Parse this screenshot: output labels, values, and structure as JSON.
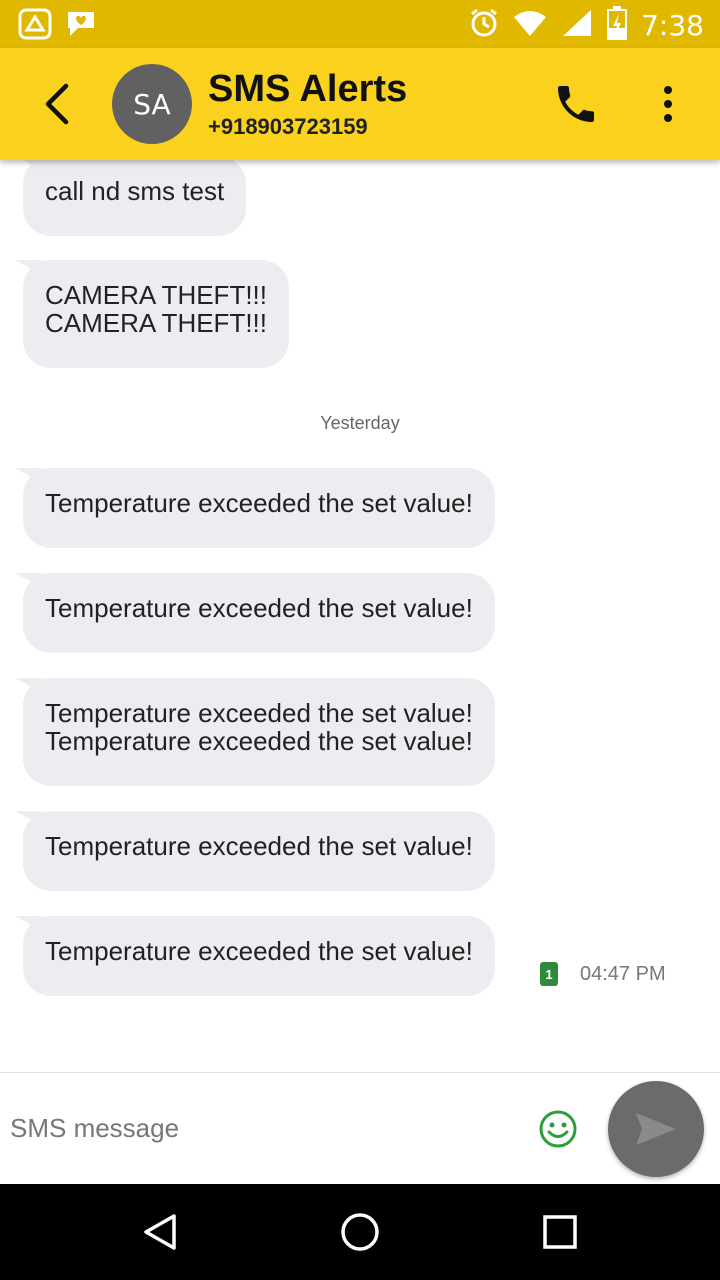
{
  "status_bar": {
    "time": "7:38",
    "icons": [
      "app-notification-icon",
      "chat-notification-icon",
      "alarm-icon",
      "wifi-icon",
      "signal-icon",
      "battery-charging-icon"
    ]
  },
  "header": {
    "avatar_initials": "SA",
    "contact_name": "SMS Alerts",
    "contact_number": "+918903723159",
    "icons": [
      "back-arrow-icon",
      "phone-icon",
      "more-vert-icon"
    ]
  },
  "messages": [
    {
      "text": "call nd sms test"
    },
    {
      "text": "CAMERA THEFT!!!\nCAMERA THEFT!!!"
    },
    {
      "text": "Temperature exceeded the set value!"
    },
    {
      "text": "Temperature exceeded the set value!"
    },
    {
      "text": "Temperature exceeded the set value!\nTemperature exceeded the set value!"
    },
    {
      "text": "Temperature exceeded the set value!"
    },
    {
      "text": "Temperature exceeded the set value!"
    }
  ],
  "date_separator": "Yesterday",
  "last_message_meta": {
    "sim_slot": "1",
    "time": "04:47 PM"
  },
  "composer": {
    "placeholder": "SMS message",
    "icons": [
      "emoji-icon",
      "send-icon"
    ]
  },
  "navigation": {
    "icons": [
      "back-nav-icon",
      "home-nav-icon",
      "recents-nav-icon"
    ]
  },
  "colors": {
    "status_bar": "#e0b800",
    "header": "#fad21e",
    "bubble": "#ececf1",
    "sim_badge": "#2e8b3a",
    "send_button": "#6b6b6b",
    "emoji_icon": "#2e9d3a"
  }
}
